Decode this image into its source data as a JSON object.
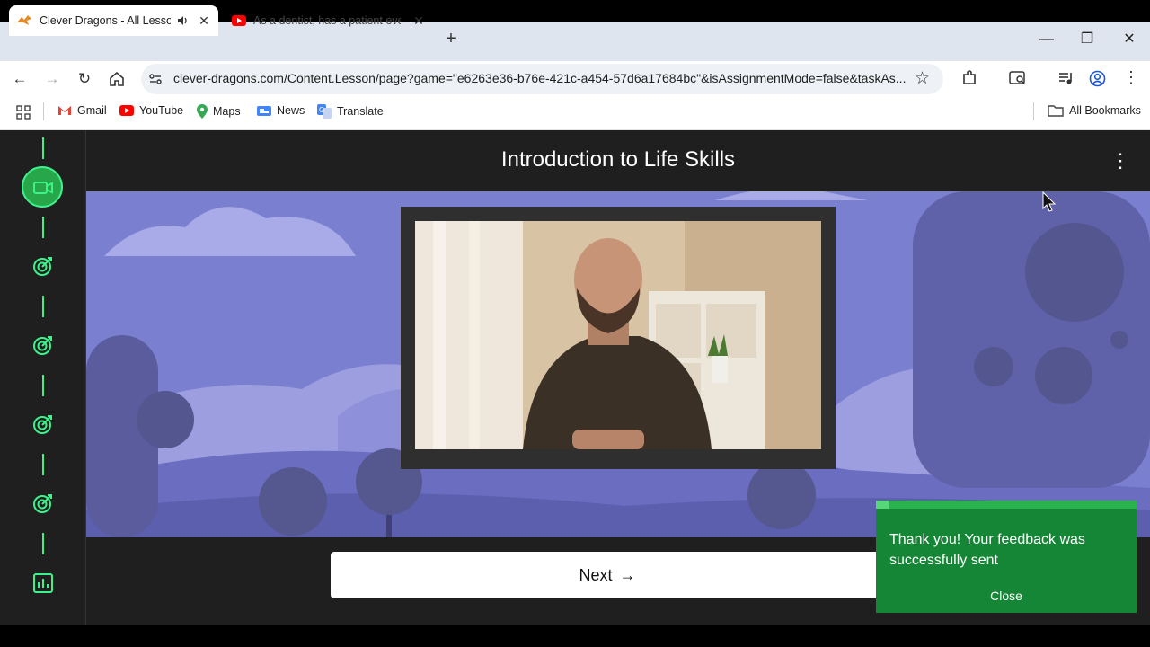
{
  "browser": {
    "tabs": [
      {
        "label": "Clever Dragons - All Lessons",
        "active": true,
        "audio": true
      },
      {
        "label": "As a dentist, has a patient ever",
        "active": false
      }
    ],
    "url": "clever-dragons.com/Content.Lesson/page?game=\"e6263e36-b76e-421c-a454-57d6a17684bc\"&isAssignmentMode=false&taskAs...",
    "bookmarks": [
      "Gmail",
      "YouTube",
      "Maps",
      "News",
      "Translate"
    ],
    "all_bookmarks": "All Bookmarks"
  },
  "lesson": {
    "title": "Introduction to Life Skills",
    "next_label": "Next",
    "next_arrow": "→"
  },
  "toast": {
    "message": "Thank you! Your feedback was successfully sent",
    "close_label": "Close"
  },
  "colors": {
    "accent_green": "#3df28b",
    "toast_green": "#158636",
    "scene_purple": "#7b7fd0"
  },
  "icons": {
    "rail": [
      "video-camera-icon",
      "target-icon",
      "target-icon",
      "target-icon",
      "target-icon",
      "bar-chart-icon"
    ]
  }
}
